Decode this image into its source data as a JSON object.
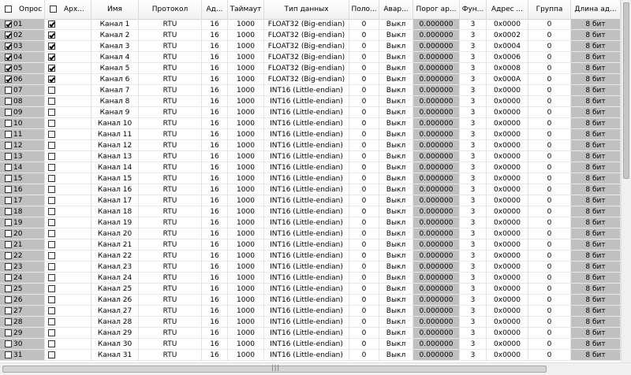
{
  "columns": [
    {
      "key": "poll",
      "label": "Опрос"
    },
    {
      "key": "archive",
      "label": "Арх..."
    },
    {
      "key": "name",
      "label": "Имя"
    },
    {
      "key": "protocol",
      "label": "Протокол"
    },
    {
      "key": "address",
      "label": "Ад..."
    },
    {
      "key": "timeout",
      "label": "Таймаут"
    },
    {
      "key": "data_type",
      "label": "Тип данных"
    },
    {
      "key": "position",
      "label": "Поло..."
    },
    {
      "key": "alarm",
      "label": "Авар..."
    },
    {
      "key": "alarm_threshold",
      "label": "Порог ар..."
    },
    {
      "key": "function",
      "label": "Фун..."
    },
    {
      "key": "reg_address",
      "label": "Адрес ..."
    },
    {
      "key": "group",
      "label": "Группа"
    },
    {
      "key": "length",
      "label": "Длина ад..."
    }
  ],
  "header_checks": {
    "poll": false,
    "archive": false
  },
  "rows": [
    {
      "num": "01",
      "poll": true,
      "archive": true,
      "name": "Канал 1",
      "protocol": "RTU",
      "address": "16",
      "timeout": "1000",
      "data_type": "FLOAT32 (Big-endian)",
      "position": "0",
      "alarm": "Выкл",
      "threshold": "0.000000",
      "function": "3",
      "reg_address": "0x0000",
      "group": "0",
      "length": "8 бит"
    },
    {
      "num": "02",
      "poll": true,
      "archive": true,
      "name": "Канал 2",
      "protocol": "RTU",
      "address": "16",
      "timeout": "1000",
      "data_type": "FLOAT32 (Big-endian)",
      "position": "0",
      "alarm": "Выкл",
      "threshold": "0.000000",
      "function": "3",
      "reg_address": "0x0002",
      "group": "0",
      "length": "8 бит"
    },
    {
      "num": "03",
      "poll": true,
      "archive": true,
      "name": "Канал 3",
      "protocol": "RTU",
      "address": "16",
      "timeout": "1000",
      "data_type": "FLOAT32 (Big-endian)",
      "position": "0",
      "alarm": "Выкл",
      "threshold": "0.000000",
      "function": "3",
      "reg_address": "0x0004",
      "group": "0",
      "length": "8 бит"
    },
    {
      "num": "04",
      "poll": true,
      "archive": true,
      "name": "Канал 4",
      "protocol": "RTU",
      "address": "16",
      "timeout": "1000",
      "data_type": "FLOAT32 (Big-endian)",
      "position": "0",
      "alarm": "Выкл",
      "threshold": "0.000000",
      "function": "3",
      "reg_address": "0x0006",
      "group": "0",
      "length": "8 бит"
    },
    {
      "num": "05",
      "poll": true,
      "archive": true,
      "name": "Канал 5",
      "protocol": "RTU",
      "address": "16",
      "timeout": "1000",
      "data_type": "FLOAT32 (Big-endian)",
      "position": "0",
      "alarm": "Выкл",
      "threshold": "0.000000",
      "function": "3",
      "reg_address": "0x0008",
      "group": "0",
      "length": "8 бит"
    },
    {
      "num": "06",
      "poll": true,
      "archive": true,
      "name": "Канал 6",
      "protocol": "RTU",
      "address": "16",
      "timeout": "1000",
      "data_type": "FLOAT32 (Big-endian)",
      "position": "0",
      "alarm": "Выкл",
      "threshold": "0.000000",
      "function": "3",
      "reg_address": "0x000A",
      "group": "0",
      "length": "8 бит"
    },
    {
      "num": "07",
      "poll": false,
      "archive": false,
      "name": "Канал 7",
      "protocol": "RTU",
      "address": "16",
      "timeout": "1000",
      "data_type": "INT16 (Little-endian)",
      "position": "0",
      "alarm": "Выкл",
      "threshold": "0.000000",
      "function": "3",
      "reg_address": "0x0000",
      "group": "0",
      "length": "8 бит"
    },
    {
      "num": "08",
      "poll": false,
      "archive": false,
      "name": "Канал 8",
      "protocol": "RTU",
      "address": "16",
      "timeout": "1000",
      "data_type": "INT16 (Little-endian)",
      "position": "0",
      "alarm": "Выкл",
      "threshold": "0.000000",
      "function": "3",
      "reg_address": "0x0000",
      "group": "0",
      "length": "8 бит"
    },
    {
      "num": "09",
      "poll": false,
      "archive": false,
      "name": "Канал 9",
      "protocol": "RTU",
      "address": "16",
      "timeout": "1000",
      "data_type": "INT16 (Little-endian)",
      "position": "0",
      "alarm": "Выкл",
      "threshold": "0.000000",
      "function": "3",
      "reg_address": "0x0000",
      "group": "0",
      "length": "8 бит"
    },
    {
      "num": "10",
      "poll": false,
      "archive": false,
      "name": "Канал 10",
      "protocol": "RTU",
      "address": "16",
      "timeout": "1000",
      "data_type": "INT16 (Little-endian)",
      "position": "0",
      "alarm": "Выкл",
      "threshold": "0.000000",
      "function": "3",
      "reg_address": "0x0000",
      "group": "0",
      "length": "8 бит"
    },
    {
      "num": "11",
      "poll": false,
      "archive": false,
      "name": "Канал 11",
      "protocol": "RTU",
      "address": "16",
      "timeout": "1000",
      "data_type": "INT16 (Little-endian)",
      "position": "0",
      "alarm": "Выкл",
      "threshold": "0.000000",
      "function": "3",
      "reg_address": "0x0000",
      "group": "0",
      "length": "8 бит"
    },
    {
      "num": "12",
      "poll": false,
      "archive": false,
      "name": "Канал 12",
      "protocol": "RTU",
      "address": "16",
      "timeout": "1000",
      "data_type": "INT16 (Little-endian)",
      "position": "0",
      "alarm": "Выкл",
      "threshold": "0.000000",
      "function": "3",
      "reg_address": "0x0000",
      "group": "0",
      "length": "8 бит"
    },
    {
      "num": "13",
      "poll": false,
      "archive": false,
      "name": "Канал 13",
      "protocol": "RTU",
      "address": "16",
      "timeout": "1000",
      "data_type": "INT16 (Little-endian)",
      "position": "0",
      "alarm": "Выкл",
      "threshold": "0.000000",
      "function": "3",
      "reg_address": "0x0000",
      "group": "0",
      "length": "8 бит"
    },
    {
      "num": "14",
      "poll": false,
      "archive": false,
      "name": "Канал 14",
      "protocol": "RTU",
      "address": "16",
      "timeout": "1000",
      "data_type": "INT16 (Little-endian)",
      "position": "0",
      "alarm": "Выкл",
      "threshold": "0.000000",
      "function": "3",
      "reg_address": "0x0000",
      "group": "0",
      "length": "8 бит"
    },
    {
      "num": "15",
      "poll": false,
      "archive": false,
      "name": "Канал 15",
      "protocol": "RTU",
      "address": "16",
      "timeout": "1000",
      "data_type": "INT16 (Little-endian)",
      "position": "0",
      "alarm": "Выкл",
      "threshold": "0.000000",
      "function": "3",
      "reg_address": "0x0000",
      "group": "0",
      "length": "8 бит"
    },
    {
      "num": "16",
      "poll": false,
      "archive": false,
      "name": "Канал 16",
      "protocol": "RTU",
      "address": "16",
      "timeout": "1000",
      "data_type": "INT16 (Little-endian)",
      "position": "0",
      "alarm": "Выкл",
      "threshold": "0.000000",
      "function": "3",
      "reg_address": "0x0000",
      "group": "0",
      "length": "8 бит"
    },
    {
      "num": "17",
      "poll": false,
      "archive": false,
      "name": "Канал 17",
      "protocol": "RTU",
      "address": "16",
      "timeout": "1000",
      "data_type": "INT16 (Little-endian)",
      "position": "0",
      "alarm": "Выкл",
      "threshold": "0.000000",
      "function": "3",
      "reg_address": "0x0000",
      "group": "0",
      "length": "8 бит"
    },
    {
      "num": "18",
      "poll": false,
      "archive": false,
      "name": "Канал 18",
      "protocol": "RTU",
      "address": "16",
      "timeout": "1000",
      "data_type": "INT16 (Little-endian)",
      "position": "0",
      "alarm": "Выкл",
      "threshold": "0.000000",
      "function": "3",
      "reg_address": "0x0000",
      "group": "0",
      "length": "8 бит"
    },
    {
      "num": "19",
      "poll": false,
      "archive": false,
      "name": "Канал 19",
      "protocol": "RTU",
      "address": "16",
      "timeout": "1000",
      "data_type": "INT16 (Little-endian)",
      "position": "0",
      "alarm": "Выкл",
      "threshold": "0.000000",
      "function": "3",
      "reg_address": "0x0000",
      "group": "0",
      "length": "8 бит"
    },
    {
      "num": "20",
      "poll": false,
      "archive": false,
      "name": "Канал 20",
      "protocol": "RTU",
      "address": "16",
      "timeout": "1000",
      "data_type": "INT16 (Little-endian)",
      "position": "0",
      "alarm": "Выкл",
      "threshold": "0.000000",
      "function": "3",
      "reg_address": "0x0000",
      "group": "0",
      "length": "8 бит"
    },
    {
      "num": "21",
      "poll": false,
      "archive": false,
      "name": "Канал 21",
      "protocol": "RTU",
      "address": "16",
      "timeout": "1000",
      "data_type": "INT16 (Little-endian)",
      "position": "0",
      "alarm": "Выкл",
      "threshold": "0.000000",
      "function": "3",
      "reg_address": "0x0000",
      "group": "0",
      "length": "8 бит"
    },
    {
      "num": "22",
      "poll": false,
      "archive": false,
      "name": "Канал 22",
      "protocol": "RTU",
      "address": "16",
      "timeout": "1000",
      "data_type": "INT16 (Little-endian)",
      "position": "0",
      "alarm": "Выкл",
      "threshold": "0.000000",
      "function": "3",
      "reg_address": "0x0000",
      "group": "0",
      "length": "8 бит"
    },
    {
      "num": "23",
      "poll": false,
      "archive": false,
      "name": "Канал 23",
      "protocol": "RTU",
      "address": "16",
      "timeout": "1000",
      "data_type": "INT16 (Little-endian)",
      "position": "0",
      "alarm": "Выкл",
      "threshold": "0.000000",
      "function": "3",
      "reg_address": "0x0000",
      "group": "0",
      "length": "8 бит"
    },
    {
      "num": "24",
      "poll": false,
      "archive": false,
      "name": "Канал 24",
      "protocol": "RTU",
      "address": "16",
      "timeout": "1000",
      "data_type": "INT16 (Little-endian)",
      "position": "0",
      "alarm": "Выкл",
      "threshold": "0.000000",
      "function": "3",
      "reg_address": "0x0000",
      "group": "0",
      "length": "8 бит"
    },
    {
      "num": "25",
      "poll": false,
      "archive": false,
      "name": "Канал 25",
      "protocol": "RTU",
      "address": "16",
      "timeout": "1000",
      "data_type": "INT16 (Little-endian)",
      "position": "0",
      "alarm": "Выкл",
      "threshold": "0.000000",
      "function": "3",
      "reg_address": "0x0000",
      "group": "0",
      "length": "8 бит"
    },
    {
      "num": "26",
      "poll": false,
      "archive": false,
      "name": "Канал 26",
      "protocol": "RTU",
      "address": "16",
      "timeout": "1000",
      "data_type": "INT16 (Little-endian)",
      "position": "0",
      "alarm": "Выкл",
      "threshold": "0.000000",
      "function": "3",
      "reg_address": "0x0000",
      "group": "0",
      "length": "8 бит"
    },
    {
      "num": "27",
      "poll": false,
      "archive": false,
      "name": "Канал 27",
      "protocol": "RTU",
      "address": "16",
      "timeout": "1000",
      "data_type": "INT16 (Little-endian)",
      "position": "0",
      "alarm": "Выкл",
      "threshold": "0.000000",
      "function": "3",
      "reg_address": "0x0000",
      "group": "0",
      "length": "8 бит"
    },
    {
      "num": "28",
      "poll": false,
      "archive": false,
      "name": "Канал 28",
      "protocol": "RTU",
      "address": "16",
      "timeout": "1000",
      "data_type": "INT16 (Little-endian)",
      "position": "0",
      "alarm": "Выкл",
      "threshold": "0.000000",
      "function": "3",
      "reg_address": "0x0000",
      "group": "0",
      "length": "8 бит"
    },
    {
      "num": "29",
      "poll": false,
      "archive": false,
      "name": "Канал 29",
      "protocol": "RTU",
      "address": "16",
      "timeout": "1000",
      "data_type": "INT16 (Little-endian)",
      "position": "0",
      "alarm": "Выкл",
      "threshold": "0.000000",
      "function": "3",
      "reg_address": "0x0000",
      "group": "0",
      "length": "8 бит"
    },
    {
      "num": "30",
      "poll": false,
      "archive": false,
      "name": "Канал 30",
      "protocol": "RTU",
      "address": "16",
      "timeout": "1000",
      "data_type": "INT16 (Little-endian)",
      "position": "0",
      "alarm": "Выкл",
      "threshold": "0.000000",
      "function": "3",
      "reg_address": "0x0000",
      "group": "0",
      "length": "8 бит"
    },
    {
      "num": "31",
      "poll": false,
      "archive": false,
      "name": "Канал 31",
      "protocol": "RTU",
      "address": "16",
      "timeout": "1000",
      "data_type": "INT16 (Little-endian)",
      "position": "0",
      "alarm": "Выкл",
      "threshold": "0.000000",
      "function": "3",
      "reg_address": "0x0000",
      "group": "0",
      "length": "8 бит"
    }
  ],
  "scrollbar": {
    "grip": "|||"
  }
}
